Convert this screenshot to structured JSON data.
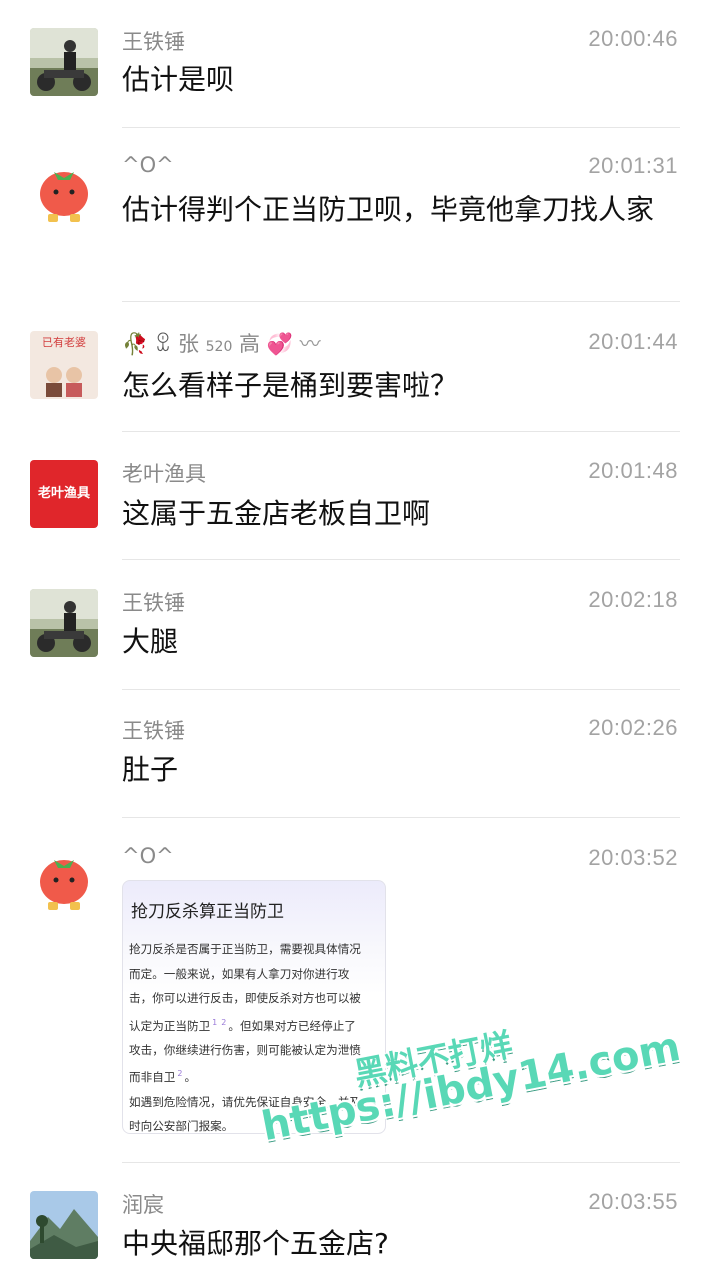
{
  "messages": [
    {
      "sender": "王铁锤",
      "time": "20:00:46",
      "text": "估计是呗",
      "avatar": "rider-photo"
    },
    {
      "sender": "^O^",
      "time": "20:01:31",
      "text": "估计得判个正当防卫呗，毕竟他拿刀找人家",
      "avatar": "tomato-emoji"
    },
    {
      "sender": "张",
      "sender_sub": "520",
      "sender_end": "高",
      "time": "20:01:44",
      "text": "怎么看样子是桶到要害啦？",
      "avatar": "couple-photo",
      "avatar_text": "已有老婆"
    },
    {
      "sender": "老叶渔具",
      "time": "20:01:48",
      "text": "这属于五金店老板自卫啊",
      "avatar": "shop-logo",
      "avatar_text": "老叶渔具"
    },
    {
      "sender": "王铁锤",
      "time": "20:02:18",
      "text": "大腿",
      "avatar": "rider-photo"
    },
    {
      "sender": "王铁锤",
      "time": "20:02:26",
      "text": "肚子"
    },
    {
      "sender": "^O^",
      "time": "20:03:52",
      "avatar": "tomato-emoji"
    },
    {
      "sender": "润宸",
      "time": "20:03:55",
      "text": "中央福邸那个五金店?",
      "avatar": "mountain-photo"
    }
  ],
  "card": {
    "title": "抢刀反杀算正当防卫",
    "line1": "抢刀反杀是否属于正当防卫，需要视具体情况",
    "line2": "而定。一般来说，如果有人拿刀对你进行攻",
    "line3": "击，你可以进行反击，即使反杀对方也可以被",
    "line4a": "认定为正当防卫",
    "ref1": "1",
    "ref2": "2",
    "line4b": "。但如果对方已经停止了",
    "line5": "攻击，你继续进行伤害，则可能被认定为泄愤",
    "line6a": "而非自卫",
    "ref3": "2",
    "line6b": "。",
    "line7": "如遇到危险情况，请优先保证自身安全，并及",
    "line8": "时向公安部门报案。"
  },
  "watermark": {
    "line1": "黑料不打烊",
    "line2": "https://ibdy14.com"
  },
  "colors": {
    "sender": "#8a8a8a",
    "time": "#a3a3a3",
    "divider": "#e6e6e6",
    "watermark": "#59d8b6"
  }
}
